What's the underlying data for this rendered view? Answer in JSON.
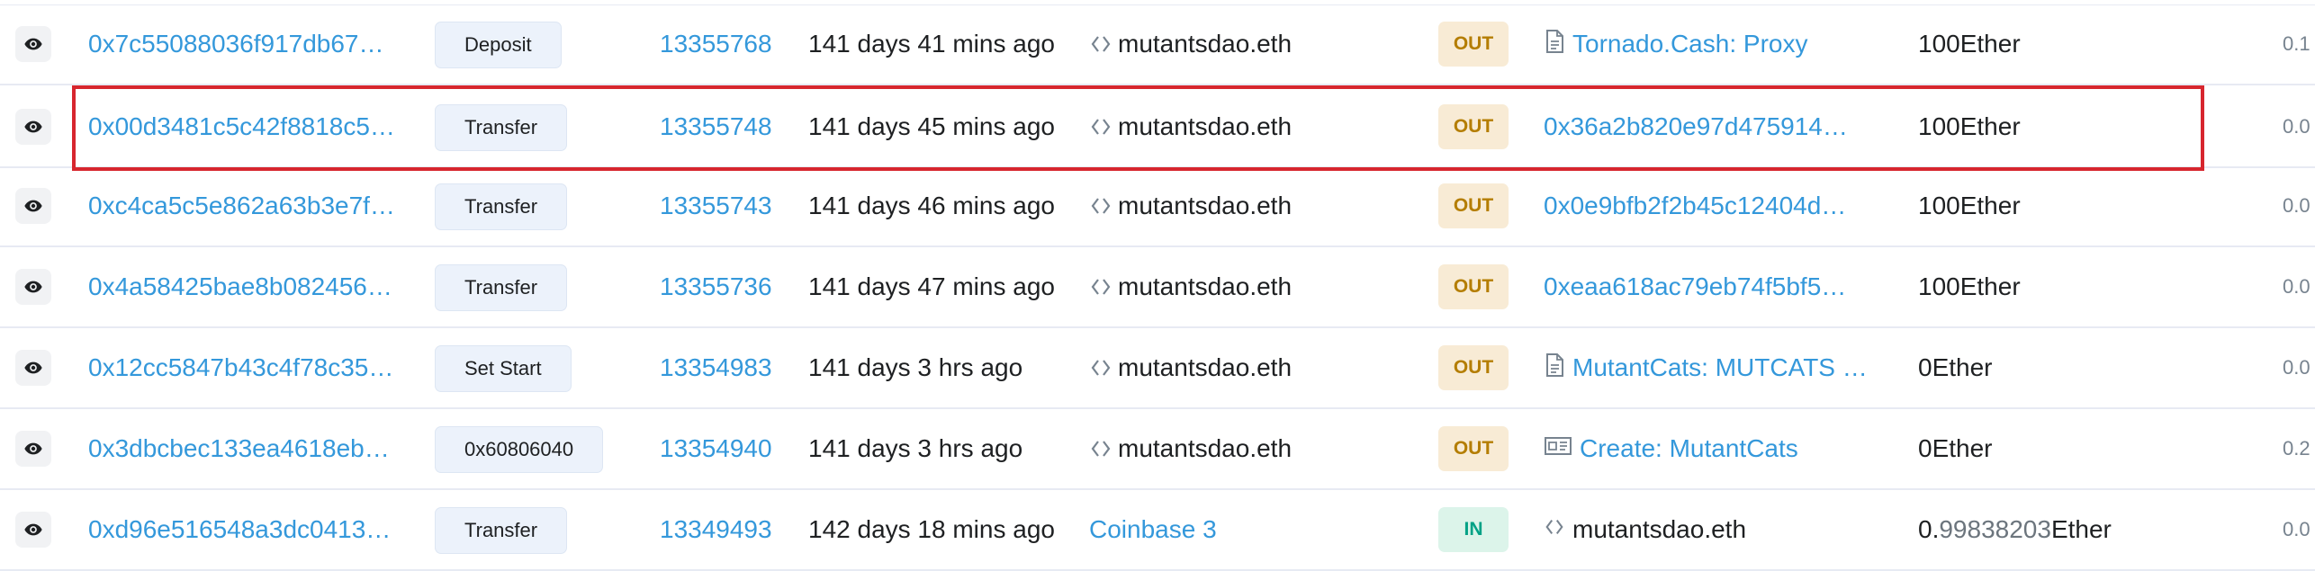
{
  "transactions": [
    {
      "hash": "0x7c55088036f917db67…",
      "method": "Deposit",
      "block": "13355768",
      "age": "141 days 41 mins ago",
      "from": "mutantsdao.eth",
      "direction": "OUT",
      "to": "Tornado.Cash: Proxy",
      "to_icon": "document-icon",
      "value_int": "100",
      "value_dec": "",
      "value_unit": " Ether",
      "fee": "0.1"
    },
    {
      "hash": "0x00d3481c5c42f8818c5…",
      "method": "Transfer",
      "block": "13355748",
      "age": "141 days 45 mins ago",
      "from": "mutantsdao.eth",
      "direction": "OUT",
      "to": "0x36a2b820e97d475914…",
      "to_icon": "",
      "value_int": "100",
      "value_dec": "",
      "value_unit": " Ether",
      "fee": "0.0"
    },
    {
      "hash": "0xc4ca5c5e862a63b3e7f…",
      "method": "Transfer",
      "block": "13355743",
      "age": "141 days 46 mins ago",
      "from": "mutantsdao.eth",
      "direction": "OUT",
      "to": "0x0e9bfb2f2b45c12404d…",
      "to_icon": "",
      "value_int": "100",
      "value_dec": "",
      "value_unit": " Ether",
      "fee": "0.0"
    },
    {
      "hash": "0x4a58425bae8b082456…",
      "method": "Transfer",
      "block": "13355736",
      "age": "141 days 47 mins ago",
      "from": "mutantsdao.eth",
      "direction": "OUT",
      "to": "0xeaa618ac79eb74f5bf5…",
      "to_icon": "",
      "value_int": "100",
      "value_dec": "",
      "value_unit": " Ether",
      "fee": "0.0"
    },
    {
      "hash": "0x12cc5847b43c4f78c35…",
      "method": "Set Start",
      "block": "13354983",
      "age": "141 days 3 hrs ago",
      "from": "mutantsdao.eth",
      "direction": "OUT",
      "to": "MutantCats: MUTCATS …",
      "to_icon": "document-icon",
      "value_int": "0",
      "value_dec": "",
      "value_unit": " Ether",
      "fee": "0.0"
    },
    {
      "hash": "0x3dbcbec133ea4618eb…",
      "method": "0x60806040",
      "block": "13354940",
      "age": "141 days 3 hrs ago",
      "from": "mutantsdao.eth",
      "direction": "OUT",
      "to": "Create: MutantCats",
      "to_icon": "contract-create-icon",
      "value_int": "0",
      "value_dec": "",
      "value_unit": " Ether",
      "fee": "0.2"
    },
    {
      "hash": "0xd96e516548a3dc0413…",
      "method": "Transfer",
      "block": "13349493",
      "age": "142 days 18 mins ago",
      "from": "Coinbase 3",
      "direction": "IN",
      "to": "mutantsdao.eth",
      "to_icon": "code-icon",
      "value_int": "0.",
      "value_dec": "99838203",
      "value_unit": " Ether",
      "fee": "0.0"
    }
  ],
  "colors": {
    "link": "#3498db",
    "out_bg": "#f8ebd5",
    "out_text": "#b47d00",
    "in_bg": "#dcf4ea",
    "in_text": "#00a186",
    "highlight": "#d7262e"
  }
}
